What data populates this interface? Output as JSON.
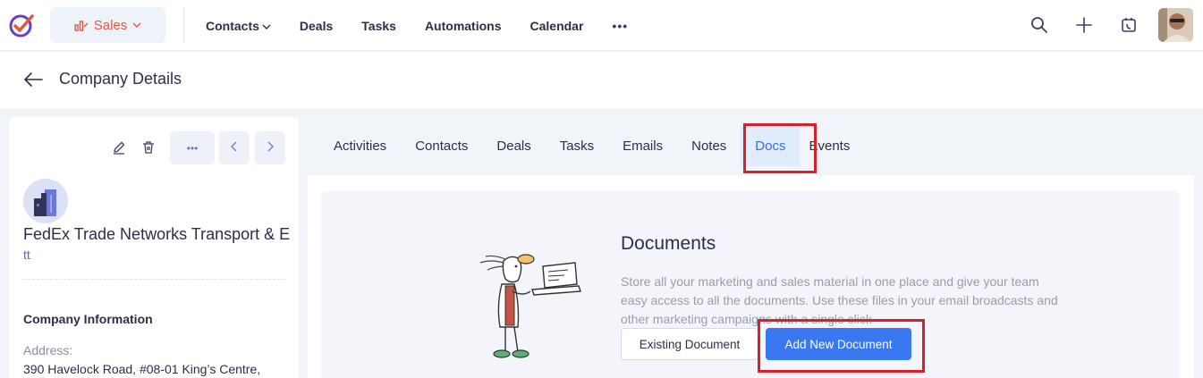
{
  "topnav": {
    "module_label": "Sales",
    "items": [
      {
        "label": "Contacts",
        "has_dropdown": true
      },
      {
        "label": "Deals"
      },
      {
        "label": "Tasks"
      },
      {
        "label": "Automations"
      },
      {
        "label": "Calendar"
      }
    ],
    "more_label": "•••",
    "icons": [
      "search-icon",
      "plus-icon",
      "phone-calendar-icon"
    ]
  },
  "header": {
    "title": "Company Details"
  },
  "company": {
    "name": "FedEx Trade Networks Transport & E",
    "subtitle": "tt",
    "section_title": "Company Information",
    "address_label": "Address:",
    "address_value": "390 Havelock Road, #08-01 King’s Centre,",
    "more_label": "•••"
  },
  "tabs": [
    {
      "label": "Activities"
    },
    {
      "label": "Contacts"
    },
    {
      "label": "Deals"
    },
    {
      "label": "Tasks"
    },
    {
      "label": "Emails"
    },
    {
      "label": "Notes"
    },
    {
      "label": "Docs",
      "active": true
    },
    {
      "label": "Events"
    }
  ],
  "docs": {
    "title": "Documents",
    "description": "Store all your marketing and sales material in one place and give your team easy access to all the documents. Use these files in your email broadcasts and other marketing campaigns with a single click",
    "existing_button": "Existing Document",
    "add_button": "Add New Document"
  },
  "colors": {
    "accent": "#3a78f2",
    "module": "#e8573c",
    "highlight": "#d8202a"
  }
}
